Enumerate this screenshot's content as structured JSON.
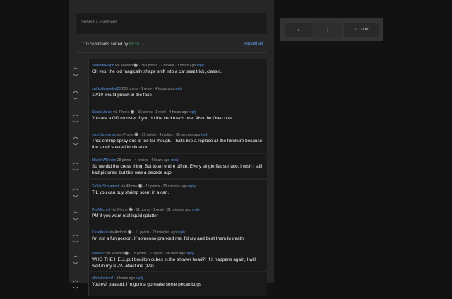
{
  "submit": {
    "placeholder": "Submit a comment"
  },
  "sort": {
    "count_text": "110 comments sorted by",
    "mode": "BEST",
    "chevron": "⌄",
    "expand": "expand all"
  },
  "vote": {
    "up": "︿",
    "down": "﹀"
  },
  "nav": {
    "prev": "‹",
    "next": "›",
    "top": "TO TOP"
  },
  "comments": [
    {
      "user": "ShredditRalph",
      "meta": "via Android 🔘 · 369 points · 7 replies · 3 hours ago",
      "reply": "reply",
      "text": "Oh yes, the old magically shape shift into a car seat trick, classic."
    },
    {
      "user": "swiftsideseeded23",
      "meta": "286 points · 1 reply · 4 hours ago",
      "reply": "reply",
      "text": "10/10 would punch in the face"
    },
    {
      "user": "NatalieJarvis",
      "meta": "via iPhone 🔘 · 55 points · 1 reply · 4 hours ago",
      "reply": "reply",
      "text": "You are a GD monster if you do the cockroach one. Also the Oreo one"
    },
    {
      "user": "vaporlamounds",
      "meta": "via iPhone 🔘 · 25 points · 4 replies · 38 minutes ago",
      "reply": "reply",
      "text": "That shrimp spray one is too far though. That's like a replace all the furniture because the smell soaked in situation..."
    },
    {
      "user": "MasterWDheim",
      "meta": "28 points · 4 replies · 4 hours ago",
      "reply": "reply",
      "text": "So we did the cress thing. But to an entire office. Every single flat surface. I wish I still had pictures, but this was a decade ago."
    },
    {
      "user": "XoStarScreamork",
      "meta": "via iPhone 🔘 · 11 points · 28 minutes ago",
      "reply": "reply",
      "text": "TIL you can buy shrimp scent in a can."
    },
    {
      "user": "PeeMitchell",
      "meta": "via iPhone 🔘 · 11 points · 1 reply · 31 minutes ago",
      "reply": "reply",
      "text": "PM if you want real liquid splatter"
    },
    {
      "user": "CaseKarlo",
      "meta": "via Android 🔘 · 11 points · 28 minutes ago",
      "reply": "reply",
      "text": "I'm not a fun person. If someone pranked me, I'd cry and beat them to death."
    },
    {
      "user": "Nate355",
      "meta": "via Android 🔘 · 18 points · 2 replies · an hour ago",
      "reply": "reply",
      "text": "WHO THE HELL put bouillon cubes in the shower head?! If it happens again, I will wait in my SUV...Blast me (1/2)"
    },
    {
      "user": "officialbatton11",
      "meta": "4 hours ago",
      "reply": "reply",
      "text": "You evil bastard, I'm gonna go make some pecan bugs"
    }
  ]
}
